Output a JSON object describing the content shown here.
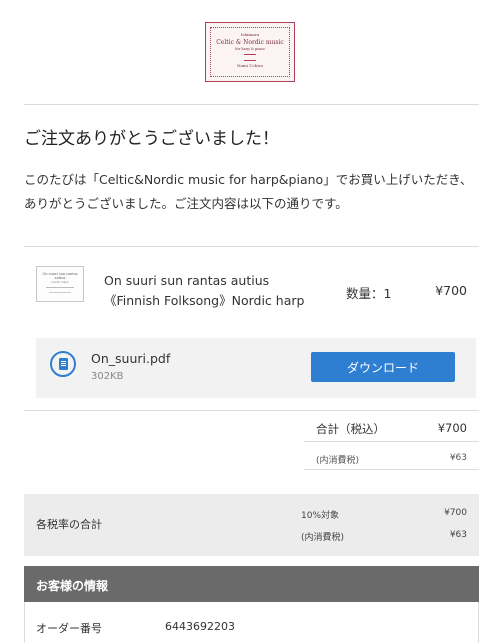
{
  "logo": {
    "line1": "Ishimaru",
    "line2": "Celtic & Nordic music",
    "line3": "for harp & piano",
    "line4": "Nami Uchiro"
  },
  "heading": "ご注文ありがとうございました！",
  "intro": "このたびは「Celtic&Nordic music for harp&piano」でお買い上げいただき、ありがとうございました。ご注文内容は以下の通りです。",
  "product": {
    "thumb_line1": "On suuri sun rantas autius",
    "thumb_line2": "nordic harp",
    "title": "On suuri sun rantas autius《Finnish Folksong》Nordic harp",
    "quantity": "数量：1",
    "price": "¥700"
  },
  "download": {
    "file_name": "On_suuri.pdf",
    "file_size": "302KB",
    "button_label": "ダウンロード",
    "icon": "document-icon"
  },
  "totals": {
    "total_label": "合計（税込）",
    "total_value": "¥700",
    "tax_label": "(内消費税)",
    "tax_value": "¥63"
  },
  "tax_rates": {
    "title": "各税率の合計",
    "rate_label": "10%対象",
    "rate_value": "¥700",
    "tax_label": "(内消費税)",
    "tax_value": "¥63"
  },
  "customer": {
    "section_title": "お客様の情報",
    "order_number_label": "オーダー番号",
    "order_number_value": "6443692203"
  },
  "colors": {
    "accent": "#2e7fd1",
    "header_bg": "#6a6a6a",
    "logo_border": "#b3405b"
  }
}
